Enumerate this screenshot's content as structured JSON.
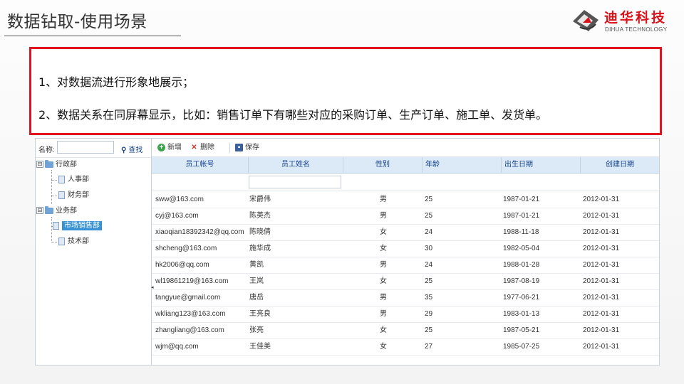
{
  "slide": {
    "title": "数据钻取-使用场景",
    "logo": {
      "cn": "迪华科技",
      "en": "DIHUA TECHNOLOGY"
    },
    "points": [
      "1、对数据流进行形象地展示；",
      "2、数据关系在同屏幕显示，比如：销售订单下有哪些对应的采购订单、生产订单、施工单、发货单。"
    ]
  },
  "search": {
    "label": "名称:",
    "value": "",
    "button": "查找",
    "icon": "search-icon"
  },
  "tree": {
    "nodes": [
      {
        "label": "行政部",
        "icon": "folder-icon",
        "expanded": true
      },
      {
        "label": "人事部",
        "icon": "document-icon"
      },
      {
        "label": "财务部",
        "icon": "document-icon"
      },
      {
        "label": "业务部",
        "icon": "folder-icon",
        "expanded": true
      },
      {
        "label": "市场销售部",
        "icon": "document-icon",
        "selected": true
      },
      {
        "label": "技术部",
        "icon": "document-icon"
      }
    ],
    "toggle_symbol": "⊟"
  },
  "toolbar": {
    "add": "新增",
    "add_icon": "plus-circle-icon",
    "delete": "删除",
    "delete_icon": "x-icon",
    "save": "保存",
    "save_icon": "floppy-icon"
  },
  "grid": {
    "columns": [
      "员工帐号",
      "员工姓名",
      "性别",
      "年龄",
      "出生日期",
      "创建日期"
    ],
    "rows": [
      [
        "sww@163.com",
        "宋爵伟",
        "男",
        "25",
        "1987-01-21",
        "2012-01-31"
      ],
      [
        "cyj@163.com",
        "陈英杰",
        "男",
        "25",
        "1987-01-21",
        "2012-01-31"
      ],
      [
        "xiaoqian18392342@qq.com",
        "陈晓倩",
        "女",
        "24",
        "1988-11-18",
        "2012-01-31"
      ],
      [
        "shcheng@163.com",
        "施华成",
        "女",
        "30",
        "1982-05-04",
        "2012-01-31"
      ],
      [
        "hk2006@qq.com",
        "黄凯",
        "男",
        "24",
        "1988-01-28",
        "2012-01-31"
      ],
      [
        "wl19861219@163.com",
        "王岚",
        "女",
        "25",
        "1987-08-19",
        "2012-01-31"
      ],
      [
        "tangyue@gmail.com",
        "唐岳",
        "男",
        "35",
        "1977-06-21",
        "2012-01-31"
      ],
      [
        "wkliang123@163.com",
        "王亮良",
        "男",
        "29",
        "1983-01-13",
        "2012-01-31"
      ],
      [
        "zhangliang@163.com",
        "张亮",
        "女",
        "25",
        "1987-05-21",
        "2012-01-31"
      ],
      [
        "wjm@qq.com",
        "王佳美",
        "女",
        "27",
        "1985-07-25",
        "2012-01-31"
      ]
    ]
  },
  "colors": {
    "accent_red": "#e0131e",
    "header_bg": "#dceaf8",
    "header_text": "#15428b",
    "selection": "#3892d3"
  }
}
